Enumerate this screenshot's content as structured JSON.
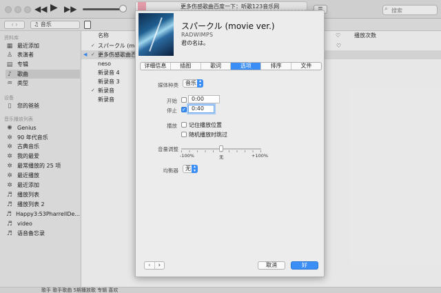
{
  "titlebar": {
    "now_playing": "更多伤感歌曲百度一下：听歌123音乐网",
    "search_placeholder": "搜索"
  },
  "toolbar": {
    "media_type": "♫ 音乐"
  },
  "sidebar": {
    "library_header": "资料库",
    "library": [
      {
        "label": "最近添加",
        "icon": "recent-icon"
      },
      {
        "label": "表演者",
        "icon": "artist-icon"
      },
      {
        "label": "专辑",
        "icon": "album-icon"
      },
      {
        "label": "歌曲",
        "icon": "song-icon"
      },
      {
        "label": "类型",
        "icon": "genre-icon"
      }
    ],
    "devices_header": "设备",
    "devices": [
      {
        "label": "您的爸爸",
        "icon": "iphone-icon"
      }
    ],
    "playlists_header": "音乐播放列表",
    "playlists": [
      {
        "label": "Genius",
        "icon": "genius-icon"
      },
      {
        "label": "90 年代音乐",
        "icon": "gear-icon"
      },
      {
        "label": "古典音乐",
        "icon": "gear-icon"
      },
      {
        "label": "我的最爱",
        "icon": "gear-icon"
      },
      {
        "label": "最常播放的 25 项",
        "icon": "gear-icon"
      },
      {
        "label": "最近播放",
        "icon": "gear-icon"
      },
      {
        "label": "最近添加",
        "icon": "gear-icon"
      },
      {
        "label": "播放列表",
        "icon": "playlist-icon"
      },
      {
        "label": "播放列表 2",
        "icon": "playlist-icon"
      },
      {
        "label": "Happy3:53PharrellDe...",
        "icon": "playlist-icon"
      },
      {
        "label": "video",
        "icon": "playlist-icon"
      },
      {
        "label": "语音备忘录",
        "icon": "playlist-icon"
      }
    ]
  },
  "table": {
    "col_name": "名称",
    "col_heart": "♡",
    "col_plays": "播放次数",
    "rows": [
      {
        "checked": true,
        "name": "スパークル (mov"
      },
      {
        "checked": true,
        "name": "更多伤感歌曲百度"
      },
      {
        "checked": false,
        "name": "neso"
      },
      {
        "checked": false,
        "name": "新录音 4"
      },
      {
        "checked": false,
        "name": "新录音 3"
      },
      {
        "checked": true,
        "name": "新录音"
      },
      {
        "checked": false,
        "name": "新录音"
      }
    ]
  },
  "bottom_strip": "歌手  歌手歌曲   5期播放歌   专辑   喜欢",
  "dialog": {
    "title": "スパークル (movie ver.)",
    "artist": "RADWIMPS",
    "album": "君の名は。",
    "tabs": [
      "详细信息",
      "插图",
      "歌词",
      "选项",
      "排序",
      "文件"
    ],
    "active_tab": "选项",
    "media_kind_label": "媒体种类",
    "media_kind_value": "音乐",
    "start_label": "开始",
    "start_checked": false,
    "start_value": "0:00",
    "stop_label": "停止",
    "stop_checked": true,
    "stop_value": "0:40",
    "playback_label": "播放",
    "remember_position": "记住播放位置",
    "skip_shuffle": "随机播放时跳过",
    "volume_label": "音量调整",
    "volume_min": "-100%",
    "volume_mid": "无",
    "volume_max": "+100%",
    "volume_value": 0,
    "equalizer_label": "均衡器",
    "equalizer_value": "无",
    "cancel": "取消",
    "ok": "好"
  },
  "colors": {
    "accent": "#3a8ef6"
  }
}
